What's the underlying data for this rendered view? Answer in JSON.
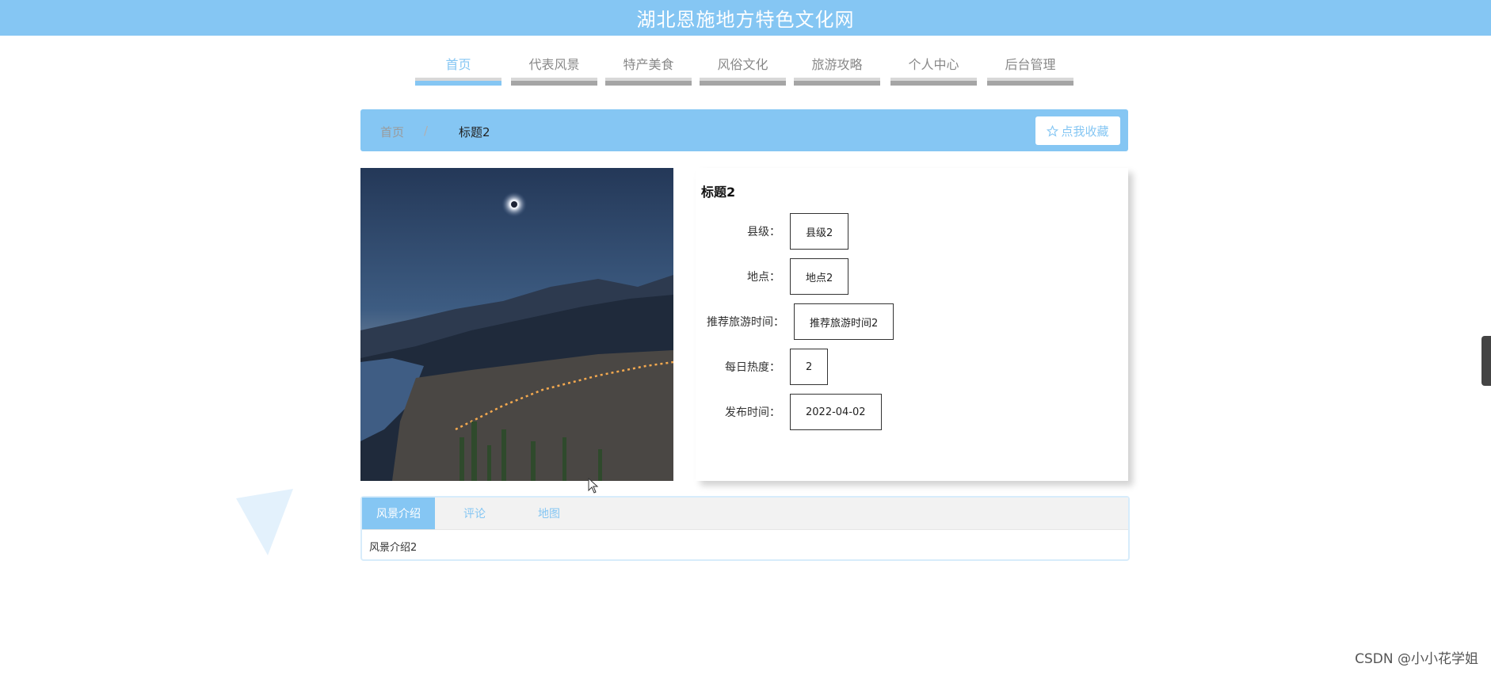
{
  "header": {
    "title": "湖北恩施地方特色文化网"
  },
  "nav": {
    "items": [
      {
        "label": "首页",
        "active": true
      },
      {
        "label": "代表风景"
      },
      {
        "label": "特产美食"
      },
      {
        "label": "风俗文化"
      },
      {
        "label": "旅游攻略"
      },
      {
        "label": "个人中心"
      },
      {
        "label": "后台管理"
      }
    ]
  },
  "breadcrumb": {
    "home": "首页",
    "separator": "/",
    "current": "标题2"
  },
  "favorite": {
    "label": "点我收藏",
    "icon": "star-outline-icon"
  },
  "detail": {
    "title": "标题2",
    "fields": [
      {
        "label": "县级：",
        "value": "县级2"
      },
      {
        "label": "地点：",
        "value": "地点2"
      },
      {
        "label": "推荐旅游时间：",
        "value": "推荐旅游时间2"
      },
      {
        "label": "每日热度：",
        "value": "2"
      },
      {
        "label": "发布时间：",
        "value": "2022-04-02"
      }
    ]
  },
  "tabs": {
    "items": [
      {
        "label": "风景介绍",
        "active": true
      },
      {
        "label": "评论"
      },
      {
        "label": "地图"
      }
    ],
    "content": "风景介绍2"
  },
  "watermark": "CSDN @小小花学姐",
  "colors": {
    "accent": "#85c6f3",
    "nav_bar": "#a5a5a5"
  }
}
